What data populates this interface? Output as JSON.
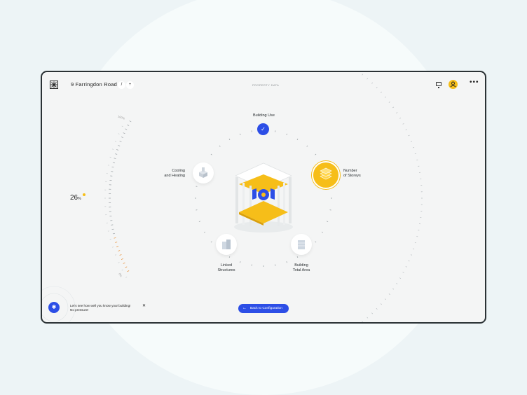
{
  "header": {
    "address": "9 Farringdon Road",
    "edit_icon": "/",
    "add_icon": "+",
    "page_label": "PROPERTY DATA",
    "more_icon": "•••"
  },
  "progress": {
    "value": "26",
    "unit": "%",
    "gauge_top_label": "100%",
    "gauge_bottom_label": "0%"
  },
  "nodes": {
    "building_use": "Building Use",
    "cooling_heating_1": "Cooling",
    "cooling_heating_2": "and Heating",
    "number_storeys_1": "Number",
    "number_storeys_2": "of Storeys",
    "linked_structures_1": "Linked",
    "linked_structures_2": "Structures",
    "building_area_1": "Building",
    "building_area_2": "Total Area"
  },
  "help": {
    "line1": "Let's see how well you know your building!",
    "line2": "No pressure!",
    "close": "✕"
  },
  "back_button": "Back to Configuration",
  "colors": {
    "accent_blue": "#2c4ee6",
    "accent_yellow": "#f6be19",
    "frame": "#2b3235"
  }
}
